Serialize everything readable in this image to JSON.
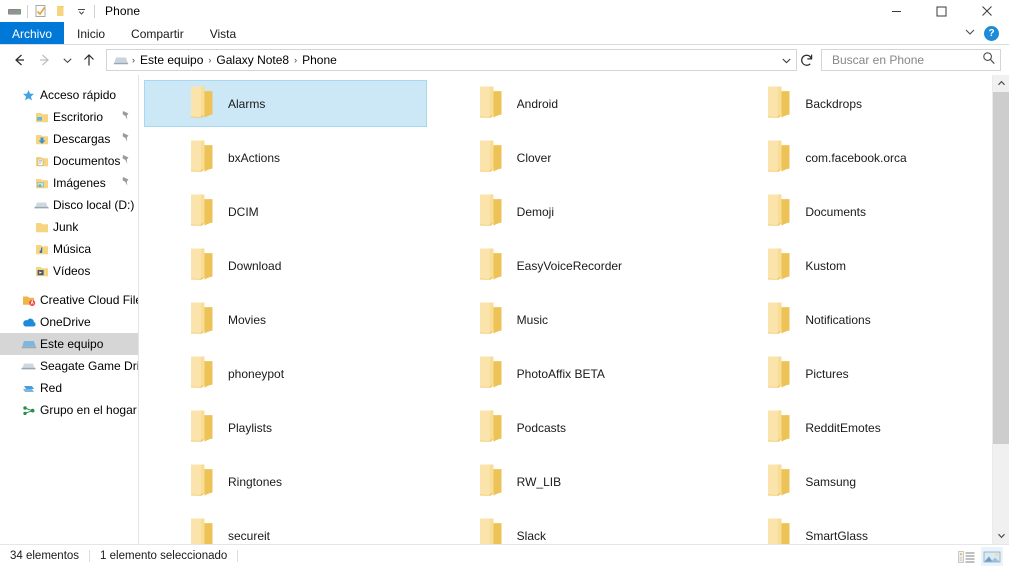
{
  "window": {
    "title": "Phone",
    "quick_access_icons": [
      "drive-icon",
      "properties-icon",
      "new-folder-icon",
      "customize-chevron-icon"
    ],
    "controls": {
      "minimize": "minimize-icon",
      "maximize": "maximize-icon",
      "close": "close-icon",
      "ribbon_collapse": "chevron-down-icon",
      "help": "?"
    }
  },
  "ribbon": {
    "tabs": [
      {
        "label": "Archivo",
        "active": true,
        "accent": "#0078d7"
      },
      {
        "label": "Inicio",
        "active": false
      },
      {
        "label": "Compartir",
        "active": false
      },
      {
        "label": "Vista",
        "active": false
      }
    ]
  },
  "navigation": {
    "back": "back-arrow-icon",
    "forward": "forward-arrow-icon",
    "recent": "chevron-down-icon",
    "up": "up-arrow-icon",
    "breadcrumb": {
      "root_icon": "computer-icon",
      "parts": [
        "Este equipo",
        "Galaxy Note8",
        "Phone"
      ],
      "separator": "›"
    },
    "dropdown": "chevron-down-icon",
    "refresh": "refresh-icon"
  },
  "search": {
    "placeholder": "Buscar en Phone",
    "value": "",
    "icon": "search-icon"
  },
  "sidebar": {
    "groups": [
      {
        "header": {
          "label": "Acceso rápido",
          "icon": "star-icon"
        },
        "items": [
          {
            "label": "Escritorio",
            "icon": "desktop-folder-icon",
            "pinned": true
          },
          {
            "label": "Descargas",
            "icon": "downloads-folder-icon",
            "pinned": true
          },
          {
            "label": "Documentos",
            "icon": "documents-folder-icon",
            "pinned": true
          },
          {
            "label": "Imágenes",
            "icon": "pictures-folder-icon",
            "pinned": true
          },
          {
            "label": "Disco local (D:)",
            "icon": "hdd-icon",
            "pinned": false
          },
          {
            "label": "Junk",
            "icon": "folder-icon",
            "pinned": false
          },
          {
            "label": "Música",
            "icon": "music-folder-icon",
            "pinned": false
          },
          {
            "label": "Vídeos",
            "icon": "video-folder-icon",
            "pinned": false
          }
        ]
      },
      {
        "items": [
          {
            "label": "Creative Cloud Files",
            "icon": "creative-cloud-icon",
            "root": true
          },
          {
            "label": "OneDrive",
            "icon": "onedrive-cloud-icon",
            "root": true
          },
          {
            "label": "Este equipo",
            "icon": "computer-icon",
            "root": true,
            "selected": true
          },
          {
            "label": "Seagate Game Drive (",
            "icon": "hdd-icon",
            "root": true
          },
          {
            "label": "Red",
            "icon": "network-icon",
            "root": true
          },
          {
            "label": "Grupo en el hogar",
            "icon": "homegroup-icon",
            "root": true
          }
        ]
      }
    ]
  },
  "files": {
    "selected": "Alarms",
    "items": [
      {
        "name": "Alarms",
        "icon": "folder-icon"
      },
      {
        "name": "Android",
        "icon": "folder-icon"
      },
      {
        "name": "Backdrops",
        "icon": "folder-icon"
      },
      {
        "name": "bxActions",
        "icon": "folder-icon"
      },
      {
        "name": "Clover",
        "icon": "folder-icon"
      },
      {
        "name": "com.facebook.orca",
        "icon": "folder-icon"
      },
      {
        "name": "DCIM",
        "icon": "folder-icon"
      },
      {
        "name": "Demoji",
        "icon": "folder-icon"
      },
      {
        "name": "Documents",
        "icon": "folder-icon"
      },
      {
        "name": "Download",
        "icon": "folder-icon"
      },
      {
        "name": "EasyVoiceRecorder",
        "icon": "folder-icon"
      },
      {
        "name": "Kustom",
        "icon": "folder-icon"
      },
      {
        "name": "Movies",
        "icon": "folder-icon"
      },
      {
        "name": "Music",
        "icon": "folder-icon"
      },
      {
        "name": "Notifications",
        "icon": "folder-icon"
      },
      {
        "name": "phoneypot",
        "icon": "folder-icon"
      },
      {
        "name": "PhotoAffix BETA",
        "icon": "folder-icon"
      },
      {
        "name": "Pictures",
        "icon": "folder-icon"
      },
      {
        "name": "Playlists",
        "icon": "folder-icon"
      },
      {
        "name": "Podcasts",
        "icon": "folder-icon"
      },
      {
        "name": "RedditEmotes",
        "icon": "folder-icon"
      },
      {
        "name": "Ringtones",
        "icon": "folder-icon"
      },
      {
        "name": "RW_LIB",
        "icon": "folder-icon"
      },
      {
        "name": "Samsung",
        "icon": "folder-icon"
      },
      {
        "name": "secureit",
        "icon": "folder-icon"
      },
      {
        "name": "Slack",
        "icon": "folder-icon"
      },
      {
        "name": "SmartGlass",
        "icon": "folder-icon"
      }
    ],
    "scroll": {
      "thumb_top_pct": 0,
      "thumb_height_pct": 81
    }
  },
  "statusbar": {
    "item_count": "34 elementos",
    "selection": "1 elemento seleccionado",
    "views": [
      {
        "name": "details-view-button",
        "active": false
      },
      {
        "name": "large-icons-view-button",
        "active": true
      }
    ]
  },
  "colors": {
    "accent": "#0078d7",
    "selection_fill": "#cce8f7",
    "selection_border": "#a7d8f0",
    "sidebar_selection": "#d6d6d6",
    "folder_yellow": "#f7d480"
  }
}
